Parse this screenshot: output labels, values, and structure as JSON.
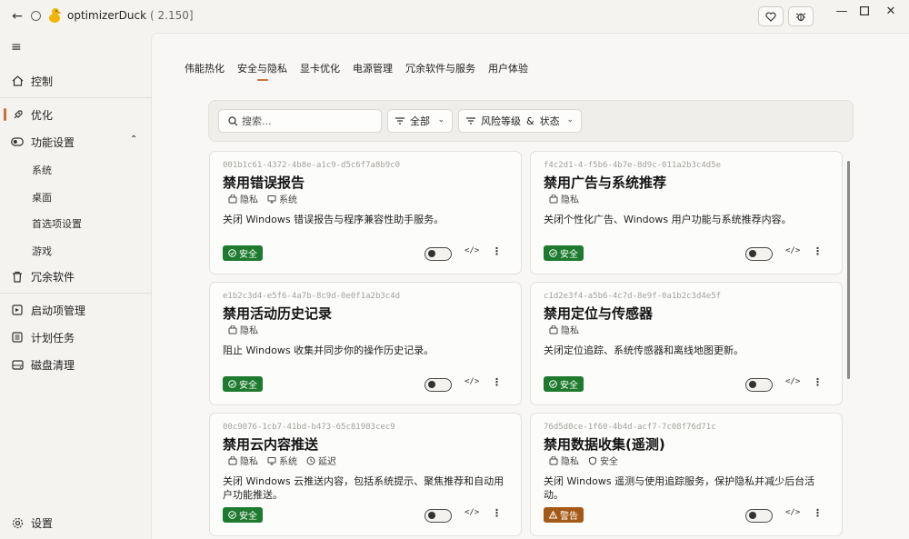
{
  "app": {
    "title": "optimizerDuck",
    "version": "( 2.150]"
  },
  "sidebar": {
    "items": [
      {
        "label": "控制"
      },
      {
        "label": "优化"
      },
      {
        "label": "功能设置"
      },
      {
        "label": "冗余软件"
      },
      {
        "label": "启动项管理"
      },
      {
        "label": "计划任务"
      },
      {
        "label": "磁盘清理"
      },
      {
        "label": "设置"
      }
    ],
    "subitems": [
      "系统",
      "桌面",
      "首选项设置",
      "游戏"
    ]
  },
  "tabs": [
    "伟能热化",
    "安全与隐私",
    "显卡优化",
    "电源管理",
    "冗余软件与服务",
    "用户体验"
  ],
  "filters": {
    "search_placeholder": "搜索...",
    "category": "全部",
    "risk_label": "风险等级",
    "amp": "&",
    "status_label": "状态"
  },
  "cards": [
    {
      "id": "001b1c61-4372-4b8e-a1c9-d5c6f7a8b9c0",
      "title": "禁用错误报告",
      "tags": [
        "隐私",
        "系统"
      ],
      "desc": "关闭 Windows 错误报告与程序兼容性助手服务。",
      "badge": "安全",
      "badge_type": "safe",
      "code": "</>",
      "more": "⋮"
    },
    {
      "id": "f4c2d1-4-f5b6-4b7e-8d9c-011a2b3c4d5e",
      "title": "禁用广告与系统推荐",
      "tags": [
        "隐私"
      ],
      "desc": "关闭个性化广告、Windows 用户功能与系统推荐内容。",
      "badge": "安全",
      "badge_type": "safe",
      "code": "</>",
      "more": "⋮"
    },
    {
      "id": "e1b2c3d4-e5f6-4a7b-8c9d-0e0f1a2b3c4d",
      "title": "禁用活动历史记录",
      "tags": [
        "隐私"
      ],
      "desc": "阻止 Windows 收集并同步你的操作历史记录。",
      "badge": "安全",
      "badge_type": "safe",
      "code": "</>",
      "more": "⋮"
    },
    {
      "id": "c1d2e3f4-a5b6-4c7d-8e9f-0a1b2c3d4e5f",
      "title": "禁用定位与传感器",
      "tags": [
        "隐私"
      ],
      "desc": "关闭定位追踪、系统传感器和离线地图更新。",
      "badge": "安全",
      "badge_type": "safe",
      "code": "</>",
      "more": "⋮"
    },
    {
      "id": "00c9076-1cb7-41bd-b473-65c81983cec9",
      "title": "禁用云内容推送",
      "tags": [
        "隐私",
        "系统",
        "延迟"
      ],
      "desc": "关闭 Windows 云推送内容，包括系统提示、聚焦推荐和自动用户功能推送。",
      "badge": "安全",
      "badge_type": "safe",
      "code": "</>",
      "more": "⋮"
    },
    {
      "id": "76d5d0ce-1f60-4b4d-acf7-7c08f76d71c",
      "title": "禁用数据收集(遥测)",
      "tags": [
        "隐私",
        "安全"
      ],
      "desc": "关闭 Windows 遥测与使用追踪服务，保护隐私并减少后台活动。",
      "badge": "警告",
      "badge_type": "warn",
      "code": "</>",
      "more": "⋮"
    }
  ],
  "colors": {
    "accent": "#c9703a",
    "safe": "#1e7a2e",
    "warn": "#a55916"
  }
}
